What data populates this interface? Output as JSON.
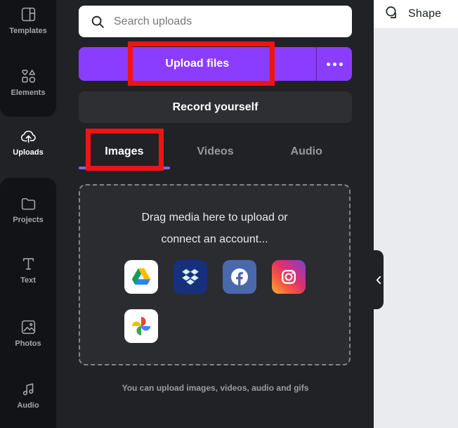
{
  "rail": {
    "items": [
      {
        "label": "Templates",
        "icon": "templates-icon",
        "selected": false
      },
      {
        "label": "Elements",
        "icon": "elements-icon",
        "selected": false
      },
      {
        "label": "Uploads",
        "icon": "uploads-icon",
        "selected": true
      },
      {
        "label": "Projects",
        "icon": "projects-icon",
        "selected": false
      },
      {
        "label": "Text",
        "icon": "text-icon",
        "selected": false
      },
      {
        "label": "Photos",
        "icon": "photos-icon",
        "selected": false
      },
      {
        "label": "Audio",
        "icon": "audio-icon",
        "selected": false
      }
    ]
  },
  "panel": {
    "search": {
      "placeholder": "Search uploads",
      "icon": "search-icon"
    },
    "upload_button": {
      "label": "Upload files"
    },
    "more_button": {
      "icon": "more-options-icon"
    },
    "record_button": {
      "label": "Record yourself"
    },
    "tabs": [
      {
        "label": "Images",
        "active": true
      },
      {
        "label": "Videos",
        "active": false
      },
      {
        "label": "Audio",
        "active": false
      }
    ],
    "dropzone": {
      "line1": "Drag media here to upload or",
      "line2": "connect an account...",
      "providers": [
        "google-drive",
        "dropbox",
        "facebook",
        "instagram",
        "google-photos"
      ]
    },
    "caption": "You can upload images, videos, audio and gifs"
  },
  "canvas": {
    "header": {
      "label": "Shape",
      "icon": "shape-tool-icon"
    }
  },
  "annotations": {
    "color": "#ee1414",
    "targets": [
      "upload-files-button",
      "images-tab"
    ]
  },
  "colors": {
    "accent_purple": "#8b3dff",
    "tab_underline": "#8766e0",
    "panel_bg": "#212226",
    "rail_group_bg": "#121317",
    "dropzone_bg": "#2b2c30",
    "canvas_bg": "#eaebee",
    "annotation_red": "#ee1414"
  }
}
